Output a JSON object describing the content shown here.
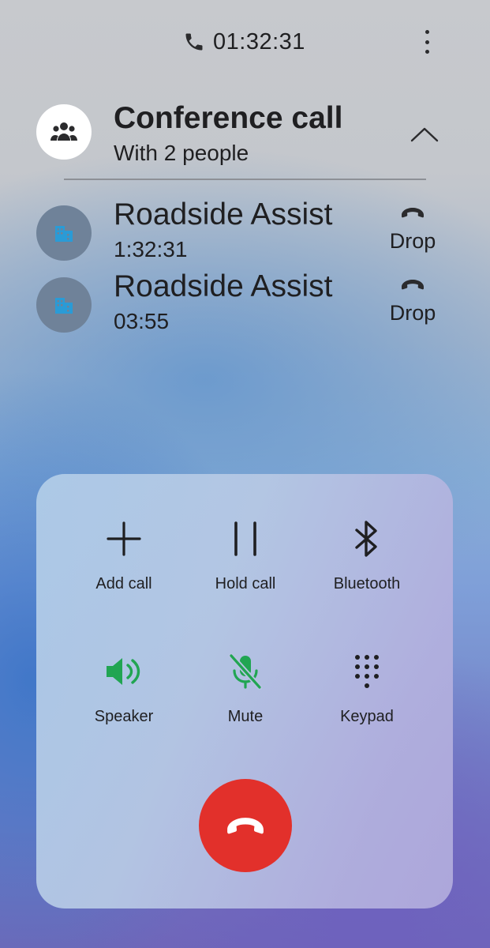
{
  "status": {
    "timer": "01:32:31",
    "phone_icon": "phone-icon",
    "more_icon": "more-vertical-icon"
  },
  "conference": {
    "title": "Conference call",
    "subtitle": "With 2 people",
    "avatar_icon": "group-icon",
    "collapse_icon": "chevron-up-icon"
  },
  "participants": [
    {
      "name": "Roadside Assist",
      "duration": "1:32:31",
      "drop_label": "Drop",
      "avatar_icon": "building-icon"
    },
    {
      "name": "Roadside Assist",
      "duration": "03:55",
      "drop_label": "Drop",
      "avatar_icon": "building-icon"
    }
  ],
  "controls": {
    "add_call": "Add call",
    "hold_call": "Hold call",
    "bluetooth": "Bluetooth",
    "speaker": "Speaker",
    "mute": "Mute",
    "keypad": "Keypad"
  },
  "end_call_icon": "end-call-icon",
  "colors": {
    "active_green": "#21a552",
    "end_call_red": "#e2302b",
    "avatar_blue": "#2a9bd6",
    "text": "#1f1f21"
  }
}
